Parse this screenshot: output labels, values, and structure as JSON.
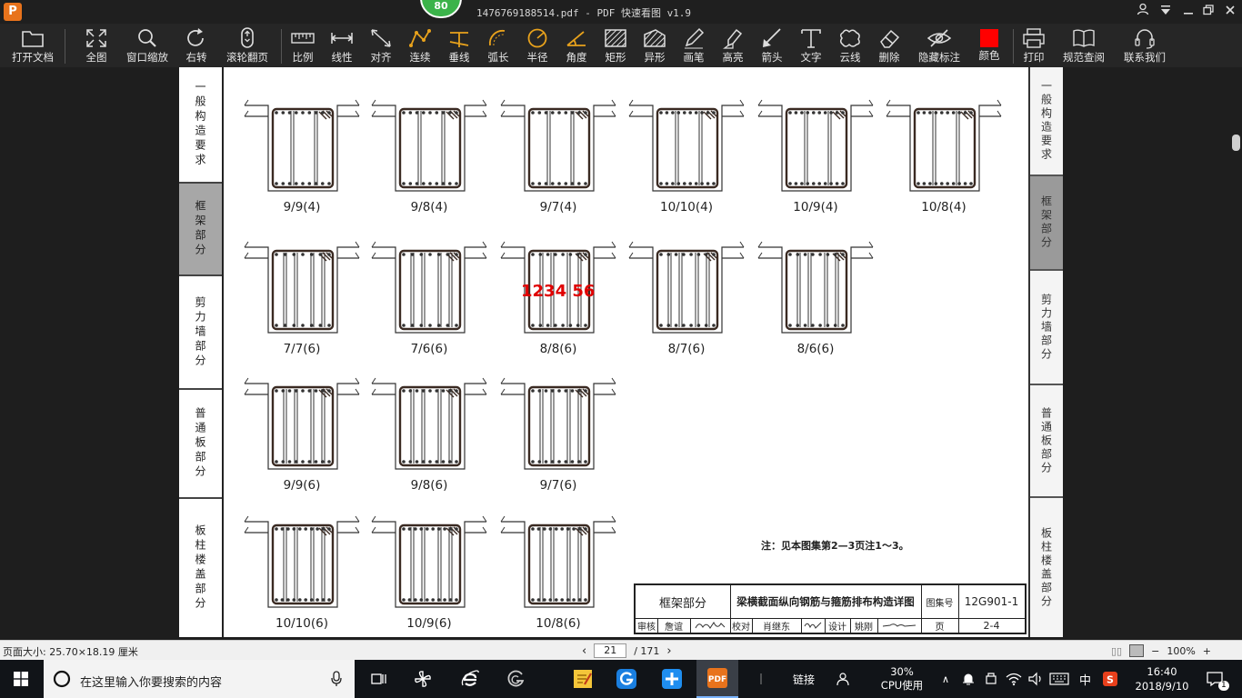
{
  "titlebar": {
    "app_logo": "P",
    "badge": "80",
    "title": "1476769188514.pdf - PDF 快速看图 v1.9"
  },
  "toolbar": {
    "tools": [
      {
        "label": "打开文档",
        "icon": "folder-icon"
      },
      {
        "label": "全图",
        "icon": "fullscreen-icon"
      },
      {
        "label": "窗口缩放",
        "icon": "magnifier-icon"
      },
      {
        "label": "右转",
        "icon": "rotate-right-icon"
      },
      {
        "label": "滚轮翻页",
        "icon": "mouse-icon"
      },
      {
        "label": "比例",
        "icon": "ruler-icon"
      },
      {
        "label": "线性",
        "icon": "linear-measure-icon"
      },
      {
        "label": "对齐",
        "icon": "align-measure-icon"
      },
      {
        "label": "连续",
        "icon": "polyline-icon"
      },
      {
        "label": "垂线",
        "icon": "perpendicular-icon"
      },
      {
        "label": "弧长",
        "icon": "arc-length-icon"
      },
      {
        "label": "半径",
        "icon": "radius-icon"
      },
      {
        "label": "角度",
        "icon": "angle-icon"
      },
      {
        "label": "矩形",
        "icon": "rectangle-area-icon"
      },
      {
        "label": "异形",
        "icon": "polygon-area-icon"
      },
      {
        "label": "画笔",
        "icon": "pen-icon"
      },
      {
        "label": "高亮",
        "icon": "highlighter-icon"
      },
      {
        "label": "箭头",
        "icon": "arrow-icon"
      },
      {
        "label": "文字",
        "icon": "text-icon"
      },
      {
        "label": "云线",
        "icon": "cloud-line-icon"
      },
      {
        "label": "删除",
        "icon": "eraser-icon"
      },
      {
        "label": "隐藏标注",
        "icon": "eye-hidden-icon"
      },
      {
        "label": "颜色",
        "icon": "color-swatch-icon"
      },
      {
        "label": "打印",
        "icon": "printer-icon"
      },
      {
        "label": "规范查阅",
        "icon": "book-icon"
      },
      {
        "label": "联系我们",
        "icon": "headset-icon"
      }
    ],
    "active_color": "#ff0000"
  },
  "document": {
    "left_tabs": [
      "一般构造要求",
      "框架部分",
      "剪力墙部分",
      "普通板部分",
      "板柱楼盖部分"
    ],
    "right_tabs": [
      "一般构造要求",
      "框架部分",
      "剪力墙部分",
      "普通板部分",
      "板柱楼盖部分"
    ],
    "active_tab": "框架部分",
    "beams": [
      {
        "label": "9/9(4)",
        "bars": 9,
        "legs": 4
      },
      {
        "label": "9/8(4)",
        "bars": 9,
        "legs": 4
      },
      {
        "label": "9/7(4)",
        "bars": 9,
        "legs": 4
      },
      {
        "label": "10/10(4)",
        "bars": 10,
        "legs": 4
      },
      {
        "label": "10/9(4)",
        "bars": 10,
        "legs": 4
      },
      {
        "label": "10/8(4)",
        "bars": 10,
        "legs": 4
      },
      {
        "label": "7/7(6)",
        "bars": 7,
        "legs": 6
      },
      {
        "label": "7/6(6)",
        "bars": 7,
        "legs": 6
      },
      {
        "label": "8/8(6)",
        "bars": 8,
        "legs": 6
      },
      {
        "label": "8/7(6)",
        "bars": 8,
        "legs": 6
      },
      {
        "label": "8/6(6)",
        "bars": 8,
        "legs": 6
      },
      {
        "label": "9/9(6)",
        "bars": 9,
        "legs": 6
      },
      {
        "label": "9/8(6)",
        "bars": 9,
        "legs": 6
      },
      {
        "label": "9/7(6)",
        "bars": 9,
        "legs": 6
      },
      {
        "label": "10/10(6)",
        "bars": 10,
        "legs": 6
      },
      {
        "label": "10/9(6)",
        "bars": 10,
        "legs": 6
      },
      {
        "label": "10/8(6)",
        "bars": 10,
        "legs": 6
      }
    ],
    "annotation": "1234  56",
    "annotation_color": "#e00000",
    "note": "注：见本图集第2—3页注1～3。",
    "title_block": {
      "section": "框架部分",
      "drawing_title": "梁横截面纵向钢筋与箍筋排布构造详图",
      "atlas_label": "图集号",
      "atlas_no": "12G901-1",
      "review_label": "审核",
      "review_name": "詹谊",
      "check_label": "校对",
      "check_name": "肖继东",
      "design_label": "设计",
      "design_name": "姚刚",
      "page_label": "页",
      "page_no": "2-4"
    }
  },
  "statusbar": {
    "page_size": "页面大小: 25.70×18.19 厘米",
    "current_page": "21",
    "total_pages": "/ 171",
    "zoom": "100%"
  },
  "taskbar": {
    "search_placeholder": "在这里输入你要搜索的内容",
    "link_label": "链接",
    "cpu_value": "30%",
    "cpu_label": "CPU使用",
    "ime": "中",
    "time": "16:40",
    "date": "2018/9/10",
    "notification_count": "1"
  }
}
